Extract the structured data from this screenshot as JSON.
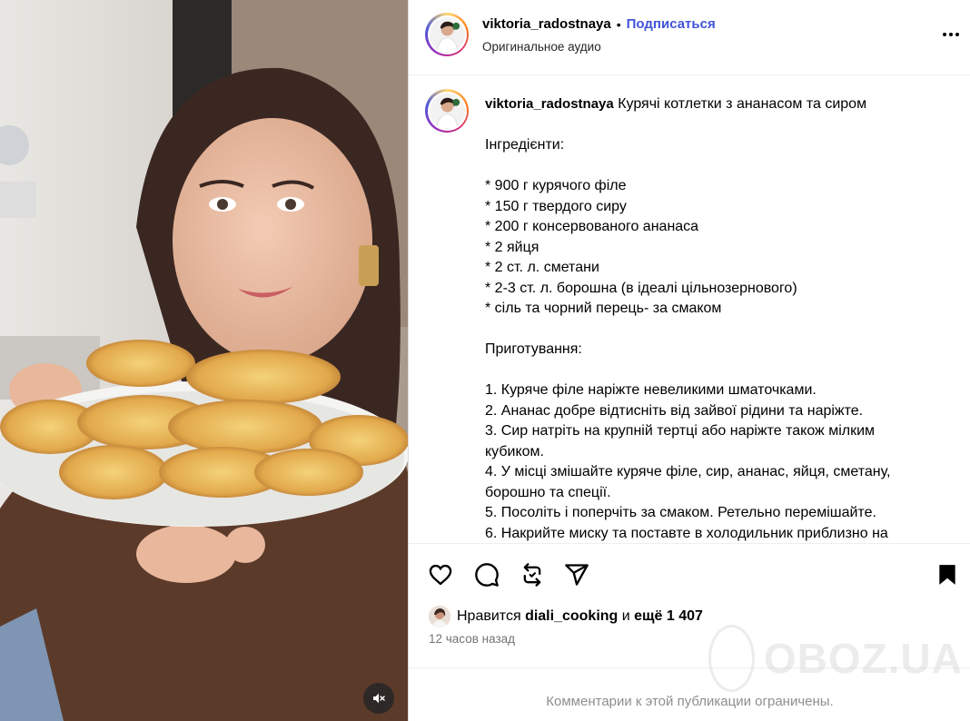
{
  "post": {
    "username": "viktoria_radostnaya",
    "separator": "•",
    "follow_label": "Подписаться",
    "audio_label": "Оригинальное аудио",
    "more_options_icon": "more-horizontal-icon"
  },
  "caption": {
    "username": "viktoria_radostnaya",
    "title": "Курячі котлетки з ананасом та сиром",
    "lines": [
      "",
      "Інгредієнти:",
      "",
      "* 900 г курячого філе",
      "* 150 г твердого сиру",
      "* 200 г консервованого ананаса",
      "* 2 яйця",
      "* 2 ст. л. сметани",
      "* 2-3 ст. л. борошна (в ідеалі цільнозернового)",
      "* сіль та чорний перець- за смаком",
      "",
      "Приготування:",
      "",
      "1. Куряче філе наріжте невеликими шматочками.",
      "2. Ананас добре відтисніть від зайвої рідини та наріжте.",
      "3. Сир натріть на крупній тертці або наріжте також мілким",
      "кубиком.",
      "4. У місці змішайте куряче філе, сир, ананас, яйця, сметану,",
      "борошно та спеції.",
      "5. Посоліть і поперчіть за смаком. Ретельно перемішайте.",
      "6. Накрийте миску та поставте в холодильник приблизно на"
    ]
  },
  "actions": {
    "like_icon": "heart-icon",
    "comment_icon": "comment-icon",
    "repost_icon": "repost-icon",
    "share_icon": "share-icon",
    "save_icon": "bookmark-icon"
  },
  "likes": {
    "prefix": "Нравится",
    "liked_by": "diali_cooking",
    "conjunction": "и",
    "others": "ещё 1 407"
  },
  "time_ago": "12 часов назад",
  "comments_notice": "Комментарии к этой публикации ограничены.",
  "media": {
    "mute_icon": "speaker-muted-icon"
  },
  "watermark": {
    "text": "OBOZ.UA"
  },
  "colors": {
    "follow": "#4153d8",
    "muted_text": "#737373",
    "border": "#dbdbdb"
  }
}
